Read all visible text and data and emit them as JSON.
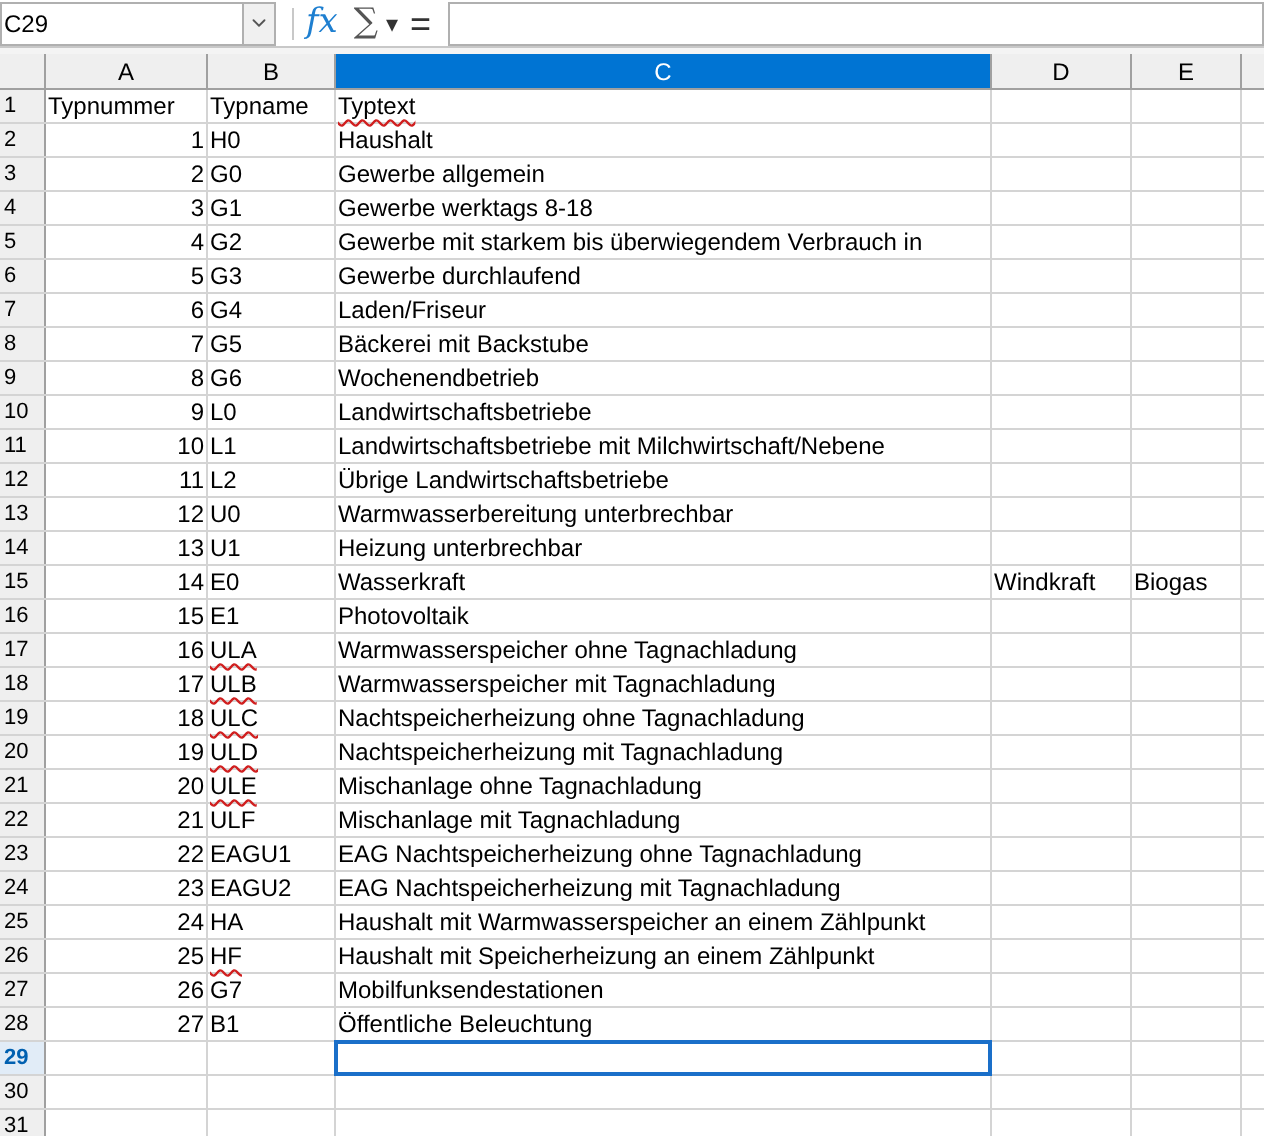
{
  "formula_bar": {
    "name_box": "C29",
    "function_wizard": "fx",
    "sum": "∑",
    "sum_menu": "▾",
    "formula": "="
  },
  "columns": [
    {
      "label": "A",
      "selected": false
    },
    {
      "label": "B",
      "selected": false
    },
    {
      "label": "C",
      "selected": true
    },
    {
      "label": "D",
      "selected": false
    },
    {
      "label": "E",
      "selected": false
    }
  ],
  "rows": [
    {
      "header": "1",
      "selected": false,
      "cells": [
        {
          "text": "Typnummer",
          "kind": "text",
          "spell_error": false
        },
        {
          "text": "Typname",
          "kind": "text",
          "spell_error": false
        },
        {
          "text": "Typtext",
          "kind": "text",
          "spell_error": true
        }
      ]
    },
    {
      "header": "2",
      "selected": false,
      "cells": [
        {
          "text": "1",
          "kind": "number",
          "spell_error": false
        },
        {
          "text": "H0",
          "kind": "text",
          "spell_error": false
        },
        {
          "text": "Haushalt",
          "kind": "text",
          "spell_error": false
        }
      ]
    },
    {
      "header": "3",
      "selected": false,
      "cells": [
        {
          "text": "2",
          "kind": "number",
          "spell_error": false
        },
        {
          "text": "G0",
          "kind": "text",
          "spell_error": false
        },
        {
          "text": "Gewerbe allgemein",
          "kind": "text",
          "spell_error": false
        }
      ]
    },
    {
      "header": "4",
      "selected": false,
      "cells": [
        {
          "text": "3",
          "kind": "number",
          "spell_error": false
        },
        {
          "text": "G1",
          "kind": "text",
          "spell_error": false
        },
        {
          "text": "Gewerbe werktags 8-18",
          "kind": "text",
          "spell_error": false
        }
      ]
    },
    {
      "header": "5",
      "selected": false,
      "cells": [
        {
          "text": "4",
          "kind": "number",
          "spell_error": false
        },
        {
          "text": "G2",
          "kind": "text",
          "spell_error": false
        },
        {
          "text": "Gewerbe mit starkem bis überwiegendem Verbrauch in",
          "kind": "text",
          "spell_error": false
        }
      ]
    },
    {
      "header": "6",
      "selected": false,
      "cells": [
        {
          "text": "5",
          "kind": "number",
          "spell_error": false
        },
        {
          "text": "G3",
          "kind": "text",
          "spell_error": false
        },
        {
          "text": "Gewerbe durchlaufend",
          "kind": "text",
          "spell_error": false
        }
      ]
    },
    {
      "header": "7",
      "selected": false,
      "cells": [
        {
          "text": "6",
          "kind": "number",
          "spell_error": false
        },
        {
          "text": "G4",
          "kind": "text",
          "spell_error": false
        },
        {
          "text": "Laden/Friseur",
          "kind": "text",
          "spell_error": false
        }
      ]
    },
    {
      "header": "8",
      "selected": false,
      "cells": [
        {
          "text": "7",
          "kind": "number",
          "spell_error": false
        },
        {
          "text": "G5",
          "kind": "text",
          "spell_error": false
        },
        {
          "text": "Bäckerei mit Backstube",
          "kind": "text",
          "spell_error": false
        }
      ]
    },
    {
      "header": "9",
      "selected": false,
      "cells": [
        {
          "text": "8",
          "kind": "number",
          "spell_error": false
        },
        {
          "text": "G6",
          "kind": "text",
          "spell_error": false
        },
        {
          "text": "Wochenendbetrieb",
          "kind": "text",
          "spell_error": false
        }
      ]
    },
    {
      "header": "10",
      "selected": false,
      "cells": [
        {
          "text": "9",
          "kind": "number",
          "spell_error": false
        },
        {
          "text": "L0",
          "kind": "text",
          "spell_error": false
        },
        {
          "text": "Landwirtschaftsbetriebe",
          "kind": "text",
          "spell_error": false
        }
      ]
    },
    {
      "header": "11",
      "selected": false,
      "cells": [
        {
          "text": "10",
          "kind": "number",
          "spell_error": false
        },
        {
          "text": "L1",
          "kind": "text",
          "spell_error": false
        },
        {
          "text": "Landwirtschaftsbetriebe mit Milchwirtschaft/Nebene",
          "kind": "text",
          "spell_error": false
        }
      ]
    },
    {
      "header": "12",
      "selected": false,
      "cells": [
        {
          "text": "11",
          "kind": "number",
          "spell_error": false
        },
        {
          "text": "L2",
          "kind": "text",
          "spell_error": false
        },
        {
          "text": "Übrige Landwirtschaftsbetriebe",
          "kind": "text",
          "spell_error": false
        }
      ]
    },
    {
      "header": "13",
      "selected": false,
      "cells": [
        {
          "text": "12",
          "kind": "number",
          "spell_error": false
        },
        {
          "text": "U0",
          "kind": "text",
          "spell_error": false
        },
        {
          "text": "Warmwasserbereitung unterbrechbar",
          "kind": "text",
          "spell_error": false
        }
      ]
    },
    {
      "header": "14",
      "selected": false,
      "cells": [
        {
          "text": "13",
          "kind": "number",
          "spell_error": false
        },
        {
          "text": "U1",
          "kind": "text",
          "spell_error": false
        },
        {
          "text": "Heizung unterbrechbar",
          "kind": "text",
          "spell_error": false
        }
      ]
    },
    {
      "header": "15",
      "selected": false,
      "cells": [
        {
          "text": "14",
          "kind": "number",
          "spell_error": false
        },
        {
          "text": "E0",
          "kind": "text",
          "spell_error": false
        },
        {
          "text": "Wasserkraft",
          "kind": "text",
          "spell_error": false
        },
        {
          "text": "Windkraft",
          "kind": "text",
          "spell_error": false
        },
        {
          "text": "Biogas",
          "kind": "text",
          "spell_error": false
        }
      ]
    },
    {
      "header": "16",
      "selected": false,
      "cells": [
        {
          "text": "15",
          "kind": "number",
          "spell_error": false
        },
        {
          "text": "E1",
          "kind": "text",
          "spell_error": false
        },
        {
          "text": "Photovoltaik",
          "kind": "text",
          "spell_error": false
        }
      ]
    },
    {
      "header": "17",
      "selected": false,
      "cells": [
        {
          "text": "16",
          "kind": "number",
          "spell_error": false
        },
        {
          "text": "ULA",
          "kind": "text",
          "spell_error": true
        },
        {
          "text": "Warmwasserspeicher ohne Tagnachladung",
          "kind": "text",
          "spell_error": false
        }
      ]
    },
    {
      "header": "18",
      "selected": false,
      "cells": [
        {
          "text": "17",
          "kind": "number",
          "spell_error": false
        },
        {
          "text": "ULB",
          "kind": "text",
          "spell_error": true
        },
        {
          "text": "Warmwasserspeicher mit Tagnachladung",
          "kind": "text",
          "spell_error": false
        }
      ]
    },
    {
      "header": "19",
      "selected": false,
      "cells": [
        {
          "text": "18",
          "kind": "number",
          "spell_error": false
        },
        {
          "text": "ULC",
          "kind": "text",
          "spell_error": true
        },
        {
          "text": "Nachtspeicherheizung ohne Tagnachladung",
          "kind": "text",
          "spell_error": false
        }
      ]
    },
    {
      "header": "20",
      "selected": false,
      "cells": [
        {
          "text": "19",
          "kind": "number",
          "spell_error": false
        },
        {
          "text": "ULD",
          "kind": "text",
          "spell_error": true
        },
        {
          "text": "Nachtspeicherheizung mit Tagnachladung",
          "kind": "text",
          "spell_error": false
        }
      ]
    },
    {
      "header": "21",
      "selected": false,
      "cells": [
        {
          "text": "20",
          "kind": "number",
          "spell_error": false
        },
        {
          "text": "ULE",
          "kind": "text",
          "spell_error": true
        },
        {
          "text": "Mischanlage ohne Tagnachladung",
          "kind": "text",
          "spell_error": false
        }
      ]
    },
    {
      "header": "22",
      "selected": false,
      "cells": [
        {
          "text": "21",
          "kind": "number",
          "spell_error": false
        },
        {
          "text": "ULF",
          "kind": "text",
          "spell_error": false
        },
        {
          "text": "Mischanlage mit Tagnachladung",
          "kind": "text",
          "spell_error": false
        }
      ]
    },
    {
      "header": "23",
      "selected": false,
      "cells": [
        {
          "text": "22",
          "kind": "number",
          "spell_error": false
        },
        {
          "text": "EAGU1",
          "kind": "text",
          "spell_error": false
        },
        {
          "text": "EAG Nachtspeicherheizung ohne Tagnachladung",
          "kind": "text",
          "spell_error": false
        }
      ]
    },
    {
      "header": "24",
      "selected": false,
      "cells": [
        {
          "text": "23",
          "kind": "number",
          "spell_error": false
        },
        {
          "text": "EAGU2",
          "kind": "text",
          "spell_error": false
        },
        {
          "text": "EAG Nachtspeicherheizung mit Tagnachladung",
          "kind": "text",
          "spell_error": false
        }
      ]
    },
    {
      "header": "25",
      "selected": false,
      "cells": [
        {
          "text": "24",
          "kind": "number",
          "spell_error": false
        },
        {
          "text": "HA",
          "kind": "text",
          "spell_error": false
        },
        {
          "text": "Haushalt mit Warmwasserspeicher an einem Zählpunkt",
          "kind": "text",
          "spell_error": false
        }
      ]
    },
    {
      "header": "26",
      "selected": false,
      "cells": [
        {
          "text": "25",
          "kind": "number",
          "spell_error": false
        },
        {
          "text": "HF",
          "kind": "text",
          "spell_error": true
        },
        {
          "text": "Haushalt mit Speicherheizung an einem Zählpunkt",
          "kind": "text",
          "spell_error": false
        }
      ]
    },
    {
      "header": "27",
      "selected": false,
      "cells": [
        {
          "text": "26",
          "kind": "number",
          "spell_error": false
        },
        {
          "text": "G7",
          "kind": "text",
          "spell_error": false
        },
        {
          "text": "Mobilfunksendestationen",
          "kind": "text",
          "spell_error": false
        }
      ]
    },
    {
      "header": "28",
      "selected": false,
      "cells": [
        {
          "text": "27",
          "kind": "number",
          "spell_error": false
        },
        {
          "text": "B1",
          "kind": "text",
          "spell_error": false
        },
        {
          "text": "Öffentliche Beleuchtung",
          "kind": "text",
          "spell_error": false
        }
      ]
    },
    {
      "header": "29",
      "selected": true,
      "cells": []
    },
    {
      "header": "30",
      "selected": false,
      "cells": []
    },
    {
      "header": "31",
      "selected": false,
      "cells": []
    }
  ]
}
